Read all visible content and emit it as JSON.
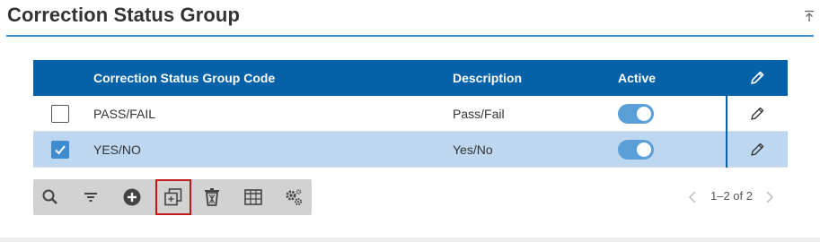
{
  "page": {
    "title": "Correction Status Group"
  },
  "grid": {
    "columns": {
      "code": "Correction Status Group Code",
      "description": "Description",
      "active": "Active"
    },
    "rows": [
      {
        "code": "PASS/FAIL",
        "description": "Pass/Fail",
        "active": true,
        "selected": false
      },
      {
        "code": "YES/NO",
        "description": "Yes/No",
        "active": true,
        "selected": true
      }
    ]
  },
  "toolbar": {
    "buttons": [
      "search-icon",
      "filter-icon",
      "add-icon",
      "copy-icon",
      "delete-icon",
      "columns-icon",
      "settings-icon"
    ],
    "highlighted": "copy-icon"
  },
  "pager": {
    "text": "1–2 of 2"
  },
  "colors": {
    "header": "#0562a8",
    "accent": "#3d8fd0",
    "selected_row": "#bcd7ef",
    "toggle_on": "#5b9fd8",
    "highlight": "#c0191c"
  }
}
